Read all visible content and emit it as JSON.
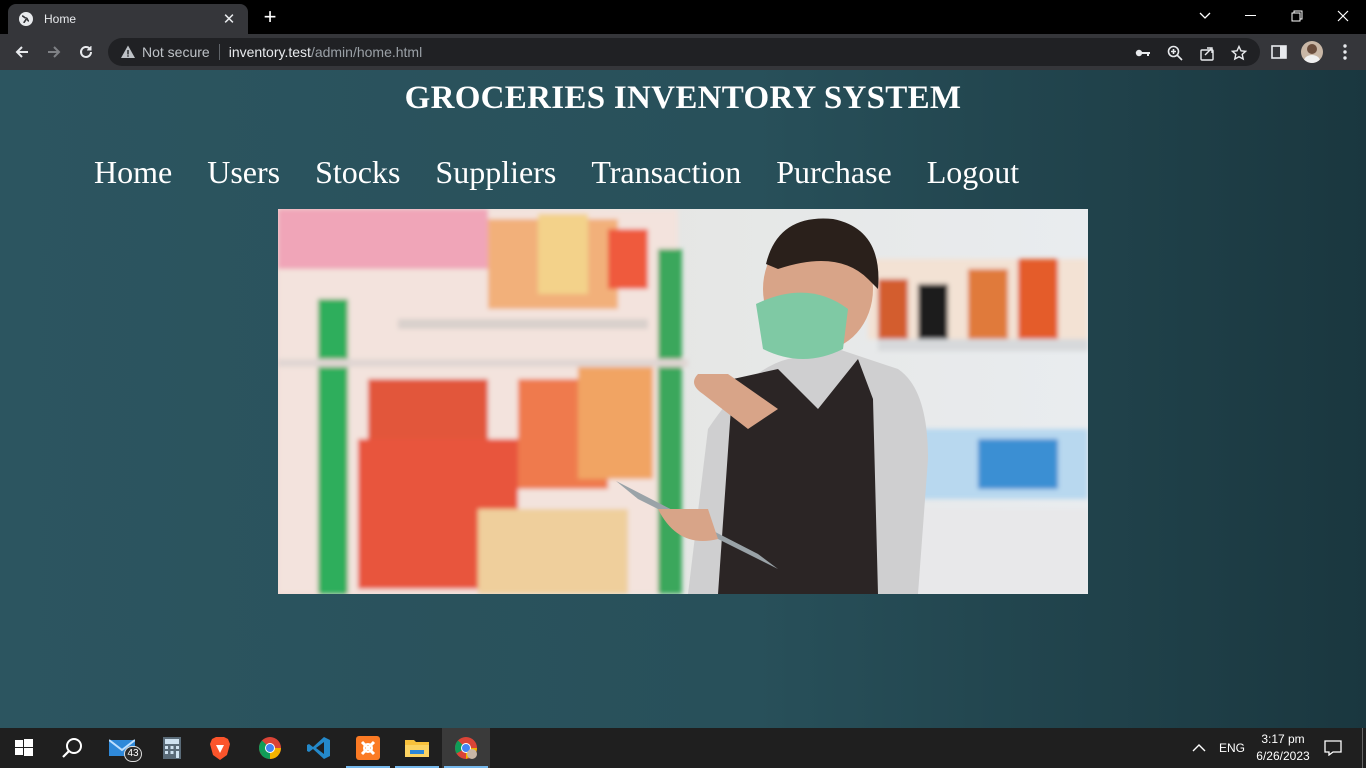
{
  "browser": {
    "tab": {
      "title": "Home"
    },
    "address": {
      "security_label": "Not secure",
      "host": "inventory.test",
      "path": "/admin/home.html"
    }
  },
  "site": {
    "title": "GROCERIES INVENTORY SYSTEM",
    "nav": [
      "Home",
      "Users",
      "Stocks",
      "Suppliers",
      "Transaction",
      "Purchase",
      "Logout"
    ],
    "hero_image": "grocery-worker-with-tablet-at-shelf"
  },
  "taskbar": {
    "mail_badge": "43",
    "language": "ENG",
    "time": "3:17 pm",
    "date": "6/26/2023"
  },
  "colors": {
    "page_background": "#2c5560",
    "page_background_right": "#1a373f",
    "tab_strip": "#000000",
    "toolbar": "#35363a"
  }
}
